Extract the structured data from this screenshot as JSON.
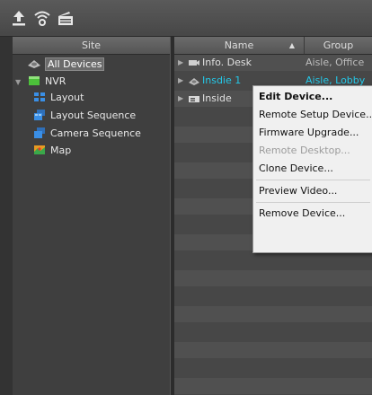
{
  "site_panel": {
    "header": "Site",
    "tree": [
      {
        "label": "All Devices",
        "icon": "eye-devices-icon",
        "selected": true
      },
      {
        "label": "NVR",
        "icon": "nvr-cube-icon"
      },
      {
        "label": "Layout",
        "icon": "layout-grid-icon"
      },
      {
        "label": "Layout Sequence",
        "icon": "layout-sequence-icon"
      },
      {
        "label": "Camera Sequence",
        "icon": "camera-sequence-icon"
      },
      {
        "label": "Map",
        "icon": "map-icon"
      }
    ]
  },
  "device_list": {
    "columns": {
      "name": "Name",
      "group": "Group"
    },
    "rows": [
      {
        "name": "Info. Desk",
        "group": "Aisle, Office",
        "icon": "camera-icon"
      },
      {
        "name": "Insdie 1",
        "group": "Aisle, Lobby",
        "icon": "eye-devices-icon",
        "highlight": true
      },
      {
        "name": "Inside",
        "group": "",
        "icon": "dvr-icon"
      }
    ]
  },
  "context_menu": {
    "items": [
      {
        "label": "Edit Device...",
        "bold": true
      },
      {
        "label": "Remote Setup Device..."
      },
      {
        "label": "Firmware Upgrade..."
      },
      {
        "label": "Remote Desktop...",
        "disabled": true
      },
      {
        "label": "Clone Device..."
      },
      {
        "label": "Preview Video..."
      },
      {
        "label": "Remove Device..."
      }
    ]
  },
  "colors": {
    "toolbar": "#4f4f4f",
    "highlight_text": "#24c8e8",
    "menu_bg": "#f0f0f0"
  }
}
